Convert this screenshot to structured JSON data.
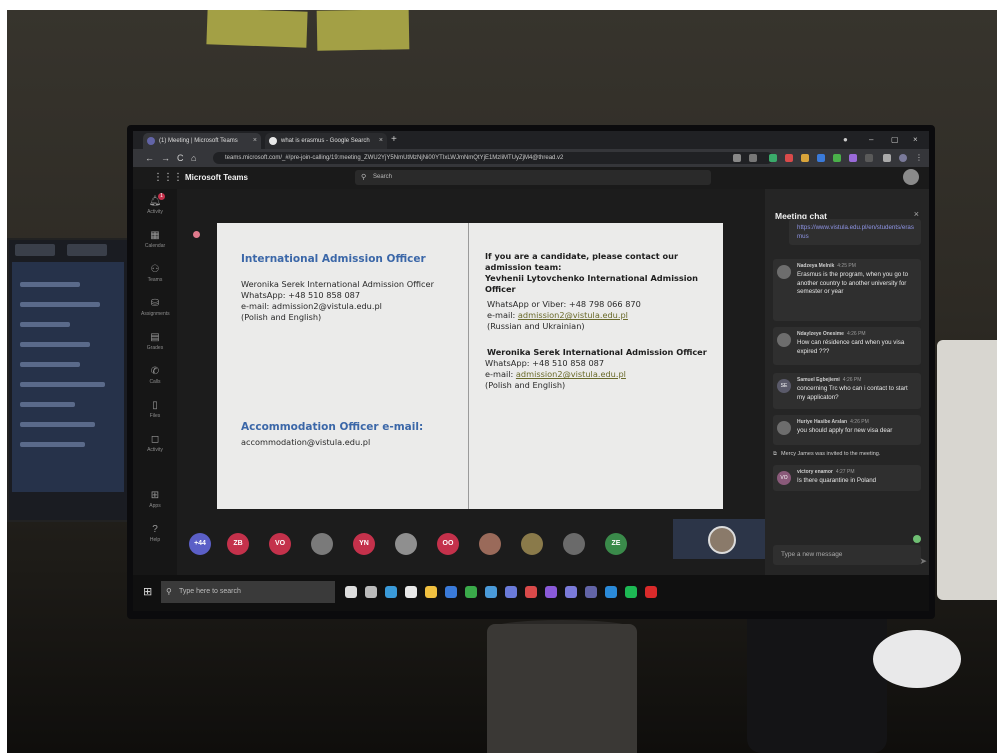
{
  "browser": {
    "tabs": [
      {
        "title": "(1) Meeting | Microsoft Teams",
        "close": "×"
      },
      {
        "title": "what is erasmus - Google Search",
        "close": "×"
      }
    ],
    "new_tab": "+",
    "url": "teams.microsoft.com/_#/pre-join-calling/19:meeting_ZWU2YjY5NmUtMzNjNi00YTIxLWJmNmQtYjE1MzliMTUyZjM4@thread.v2",
    "nav": {
      "back": "←",
      "forward": "→",
      "reload": "C",
      "home": "⌂"
    },
    "window_controls": {
      "minimize": "–",
      "maximize": "▢",
      "close": "×"
    }
  },
  "teams": {
    "app_launcher": "⋮⋮⋮",
    "title": "Microsoft Teams",
    "search_placeholder": "Search",
    "search_icon": "⚲",
    "rail": [
      {
        "label": "Activity",
        "icon": "bell-icon",
        "glyph": "🔔︎",
        "badge": "1"
      },
      {
        "label": "Calendar",
        "icon": "calendar-icon",
        "glyph": "▦"
      },
      {
        "label": "Teams",
        "icon": "teams-icon",
        "glyph": "⚇"
      },
      {
        "label": "Assignments",
        "icon": "assignments-icon",
        "glyph": "⛁"
      },
      {
        "label": "Grades",
        "icon": "grades-icon",
        "glyph": "▤"
      },
      {
        "label": "Calls",
        "icon": "calls-icon",
        "glyph": "✆"
      },
      {
        "label": "Files",
        "icon": "files-icon",
        "glyph": "▯"
      },
      {
        "label": "Activity",
        "icon": "activity-icon",
        "glyph": "◻"
      },
      {
        "label": "Apps",
        "icon": "apps-icon",
        "glyph": "⊞"
      },
      {
        "label": "Help",
        "icon": "help-icon",
        "glyph": "?"
      }
    ]
  },
  "slide": {
    "left": {
      "heading1": "International Admission Officer",
      "lines1": [
        "Weronika Serek International Admission Officer",
        "WhatsApp: +48 510 858 087",
        " e-mail: admission2@vistula.edu.pl",
        "(Polish and English)"
      ],
      "heading2": "Accommodation Officer e-mail:",
      "line2": "accommodation@vistula.edu.pl"
    },
    "right": {
      "intro": [
        "If you are a candidate, please contact our",
        "admission team:",
        "Yevhenii Lytovchenko International Admission",
        "Officer"
      ],
      "contact1_lines": [
        "WhatsApp or Viber: +48 798 066 870",
        "e-mail: ",
        "(Russian and Ukrainian)"
      ],
      "contact1_email": "admission2@vistula.edu.pl",
      "contact2_name": "Weronika Serek International Admission Officer",
      "contact2_lines": [
        "WhatsApp: +48 510 858 087",
        "e-mail: ",
        " (Polish and English)"
      ],
      "contact2_email": "admission2@vistula.edu.pl"
    }
  },
  "participants": [
    {
      "initials": "+44",
      "color": "#5b5fc7"
    },
    {
      "initials": "ZB",
      "color": "#c4314b"
    },
    {
      "initials": "VO",
      "color": "#c4314b"
    },
    {
      "initials": "",
      "color": "#7a7a7a"
    },
    {
      "initials": "YN",
      "color": "#c4314b"
    },
    {
      "initials": "",
      "color": "#8f8f8f"
    },
    {
      "initials": "OO",
      "color": "#c4314b"
    },
    {
      "initials": "",
      "color": "#9a6a5a"
    },
    {
      "initials": "",
      "color": "#8a7a4a"
    },
    {
      "initials": "",
      "color": "#6a6a6a"
    },
    {
      "initials": "ZE",
      "color": "#3a8a4a"
    }
  ],
  "chat": {
    "title": "Meeting chat",
    "close": "×",
    "link": "https://www.vistula.edu.pl/en/students/erasmus",
    "messages": [
      {
        "author": "Nadzeya Melnik",
        "time": "4:25 PM",
        "avatar": "",
        "text": "Erasmus is the program, when you go to another country to another university for semester or year"
      },
      {
        "author": "Ndaylzeye Onesime",
        "time": "4:26 PM",
        "avatar": "",
        "text": "How can résidence card when you visa expired ???"
      },
      {
        "author": "Samuel Egbejiemi",
        "time": "4:26 PM",
        "avatar": "SE",
        "text": "concerning Trc who can i contact to start my applicaton?"
      },
      {
        "author": "Huriye Hasibe Arslan",
        "time": "4:26 PM",
        "avatar": "",
        "text": "you should apply for new visa dear"
      },
      {
        "author": "victory enamor",
        "time": "4:27 PM",
        "avatar": "VO",
        "text": "Is there quarantine in Poland"
      }
    ],
    "system": "Mercy James was invited to the meeting.",
    "compose_placeholder": "Type a new message",
    "send": "➤"
  },
  "taskbar": {
    "start": "⊞",
    "search_placeholder": "Type here to search",
    "search_icon": "⚲",
    "icons": [
      {
        "name": "cortana-icon",
        "color": "#dddddd"
      },
      {
        "name": "task-view-icon",
        "color": "#bbbbbb"
      },
      {
        "name": "edge-icon",
        "color": "#3a9ad9"
      },
      {
        "name": "store-icon",
        "color": "#e8e8e8"
      },
      {
        "name": "mail-icon",
        "color": "#f0c040"
      },
      {
        "name": "explorer-icon",
        "color": "#3a7ad9"
      },
      {
        "name": "chrome-icon",
        "color": "#3aaa4a"
      },
      {
        "name": "app-icon-1",
        "color": "#4a9ad9"
      },
      {
        "name": "app-icon-2",
        "color": "#6a7ad9"
      },
      {
        "name": "app-icon-3",
        "color": "#d94a4a"
      },
      {
        "name": "visual-studio-icon",
        "color": "#8a5ad9"
      },
      {
        "name": "app-icon-4",
        "color": "#7a7ad9"
      },
      {
        "name": "teams-taskbar-icon",
        "color": "#6264a7"
      },
      {
        "name": "vscode-icon",
        "color": "#2a8ad9"
      },
      {
        "name": "spotify-icon",
        "color": "#1db954"
      },
      {
        "name": "opera-icon",
        "color": "#d92a2a"
      }
    ]
  }
}
